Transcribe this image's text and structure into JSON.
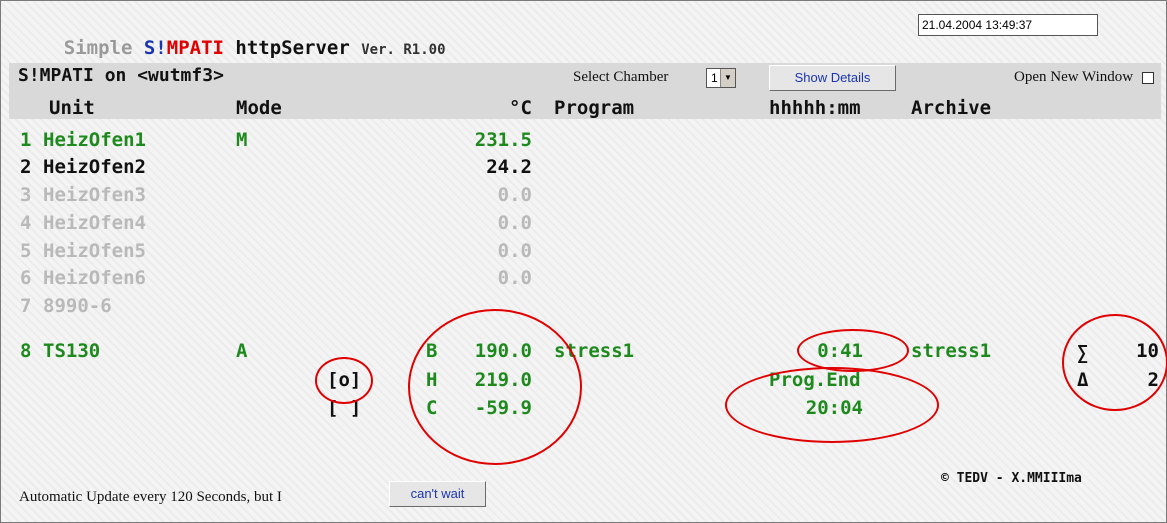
{
  "title": {
    "simple": "Simple ",
    "s": "S!",
    "m": "M",
    "pati": "PATI",
    "rest": " httpServer ",
    "version": "Ver. R1.00"
  },
  "datetime": "21.04.2004 13:49:37",
  "server_label": "S!MPATI on <wutmf3>",
  "select_chamber": {
    "label": "Select Chamber",
    "value": "1"
  },
  "show_details": "Show Details",
  "open_new_window": "Open New Window",
  "columns": {
    "unit": "Unit",
    "mode": "Mode",
    "temp": "°C",
    "program": "Program",
    "time": "hhhhh:mm",
    "archive": "Archive"
  },
  "units": [
    {
      "num": "1",
      "name": "HeizOfen1",
      "mode": "M",
      "temp": "231.5"
    },
    {
      "num": "2",
      "name": "HeizOfen2",
      "mode": "",
      "temp": "24.2"
    },
    {
      "num": "3",
      "name": "HeizOfen3",
      "mode": "",
      "temp": "0.0"
    },
    {
      "num": "4",
      "name": "HeizOfen4",
      "mode": "",
      "temp": "0.0"
    },
    {
      "num": "5",
      "name": "HeizOfen5",
      "mode": "",
      "temp": "0.0"
    },
    {
      "num": "6",
      "name": "HeizOfen6",
      "mode": "",
      "temp": "0.0"
    },
    {
      "num": "7",
      "name": "8990-6",
      "mode": "",
      "temp": ""
    }
  ],
  "unit8": {
    "num": "8",
    "name": "TS130",
    "mode": "A",
    "status1": "[o]",
    "status2": "[ ]",
    "b_label": "B",
    "b_val": "190.0",
    "h_label": "H",
    "h_val": "219.0",
    "c_label": "C",
    "c_val": "-59.9",
    "program": "stress1",
    "time": "0:41",
    "archive": "stress1",
    "prog_end_label": "Prog.End",
    "prog_end": "20:04",
    "sigma": "∑",
    "sigma_val": "10",
    "delta": "Δ",
    "delta_val": "2"
  },
  "footer": {
    "auto_update": "Automatic Update every 120 Seconds, but I",
    "cant_wait": "can't wait",
    "copyright": "© TEDV - X.MMIIIma"
  },
  "colors": {
    "green": "#1e8a1e",
    "blue": "#1b35b0",
    "red": "#e00000",
    "gray": "#b9b9b9"
  }
}
